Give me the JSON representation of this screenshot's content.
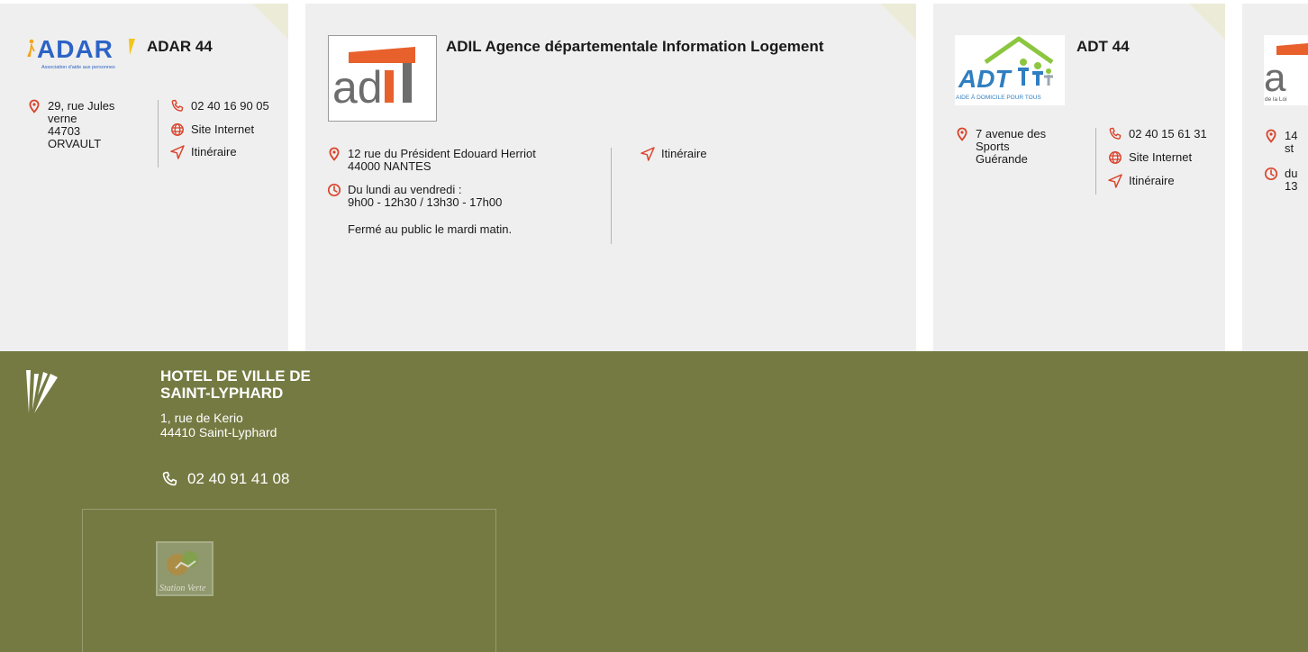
{
  "cards": [
    {
      "title": "ADAR 44",
      "logo": {
        "text": "ADAR",
        "tagline": "Association d'aide aux personnes"
      },
      "address": [
        "29, rue Jules",
        "verne",
        "44703",
        "ORVAULT"
      ],
      "phone": "02 40 16 90 05",
      "website": "Site Internet",
      "itinerary": "Itinéraire"
    },
    {
      "title": "ADIL Agence départementale Information Logement",
      "logo": {
        "text": "adil"
      },
      "address": [
        "12 rue du Président Edouard Herriot",
        "44000 NANTES"
      ],
      "hours": [
        "Du lundi au vendredi :",
        "9h00 - 12h30 / 13h30 - 17h00"
      ],
      "note": "Fermé au public le mardi matin.",
      "itinerary": "Itinéraire"
    },
    {
      "title": "ADT 44",
      "logo": {
        "text": "ADT",
        "tagline": "AIDE À DOMICILE POUR TOUS"
      },
      "address": [
        "7 avenue des",
        "Sports",
        "Guérande"
      ],
      "phone": "02 40 15 61 31",
      "website": "Site Internet",
      "itinerary": "Itinéraire"
    },
    {
      "logo": {
        "text": "a",
        "tagline": "de la Loi"
      },
      "address": [
        "14",
        "st"
      ],
      "hours": [
        "du",
        "13"
      ]
    }
  ],
  "footer": {
    "title": "HOTEL DE VILLE DE SAINT-LYPHARD",
    "address": [
      "1, rue de Kerio",
      "44410 Saint-Lyphard"
    ],
    "phone": "02 40 91 41 08",
    "badge_text": "Station Verte"
  },
  "colors": {
    "accent": "#d9442c",
    "footer": "#757a42",
    "card": "#efefef"
  },
  "icons": [
    "location-pin-icon",
    "phone-icon",
    "globe-icon",
    "navigation-arrow-icon",
    "clock-icon"
  ]
}
